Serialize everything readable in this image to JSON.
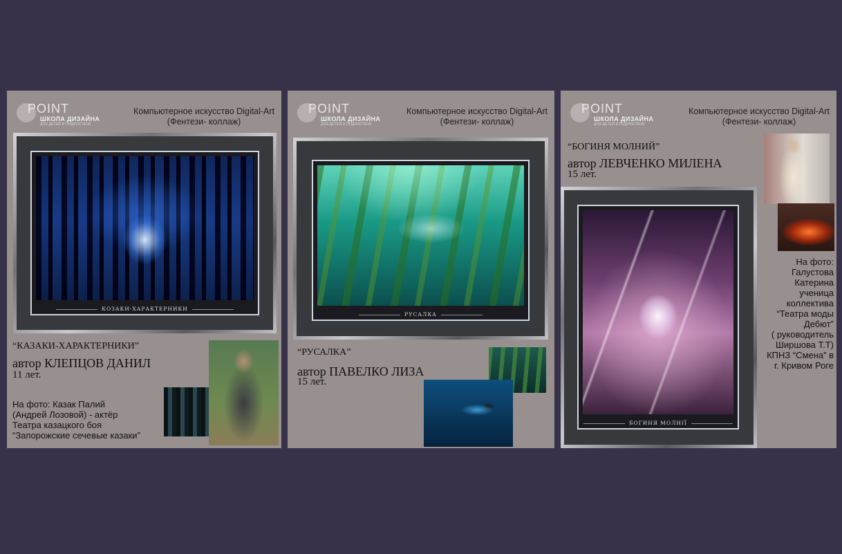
{
  "header": {
    "logo_word": "POINT",
    "logo_sub": "ШКОЛА ДИЗАЙНА",
    "logo_tiny": "ДЛЯ ДЕТЕЙ И ПОДРОСТКОВ",
    "line1": "Компьютерное искусство Digital-Art",
    "line2": "(Фентези- коллаж)"
  },
  "panels": [
    {
      "title": "“КАЗАКИ-ХАРАКТЕРНИКИ”",
      "author": "автор КЛЕПЦОВ ДАНИЛ",
      "age": "11 лет.",
      "artwork_caption": "КОЗАКИ-ХАРАКТЕРНИКИ",
      "note_lines": [
        "На фото: Казак Палий",
        "(Андрей Лозовой) - актёр",
        "Театра казацкого боя",
        "“Запорожские сечевые казаки”"
      ]
    },
    {
      "title": "“РУСАЛКА”",
      "author": "автор ПАВЕЛКО ЛИЗА",
      "age": "15 лет.",
      "artwork_caption": "РУСАЛКА"
    },
    {
      "title": "“БОГИНЯ МОЛНИЙ”",
      "author": "автор ЛЕВЧЕНКО МИЛЕНА",
      "age": "15 лет.",
      "artwork_caption": "БОГИНЯ МОЛНІЇ",
      "note_lines": [
        "На фото:",
        "Галустова",
        "Катерина",
        "ученица",
        "коллектива",
        "“Театра моды",
        "Дебют”",
        "( руководитель",
        "Ширшова Т.Т)",
        "КПНЗ “Смена” в",
        "г. Кривом Роге"
      ]
    }
  ]
}
